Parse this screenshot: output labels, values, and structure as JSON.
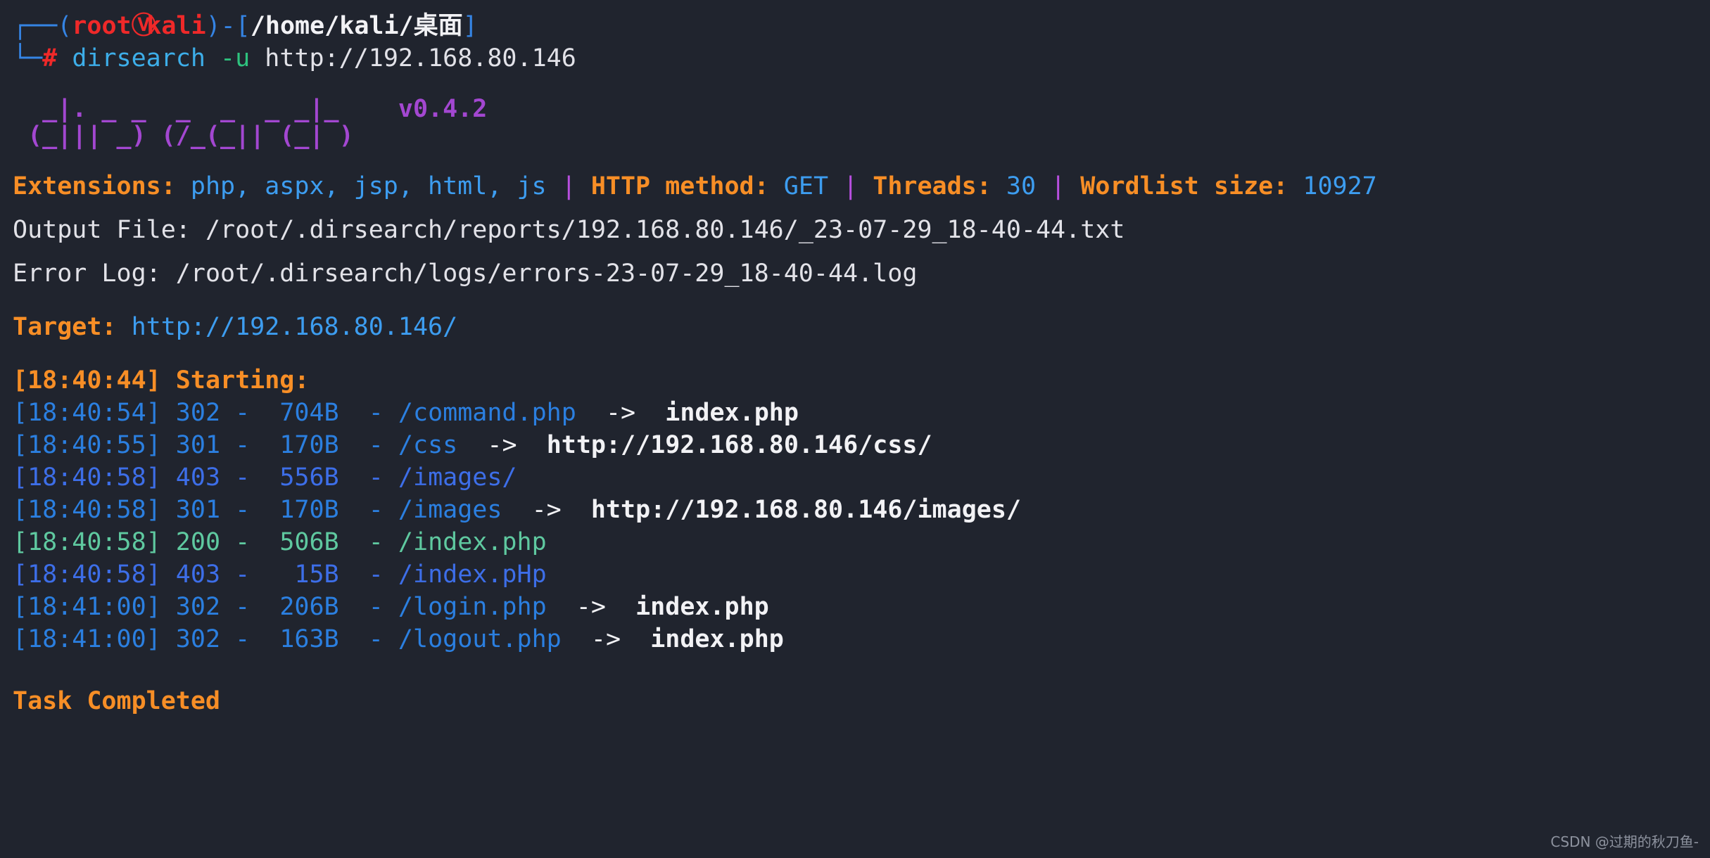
{
  "terminal": {
    "background": "#20242e",
    "prompt": {
      "box_top": "┌──",
      "box_bottom": "└─",
      "paren_open": "(",
      "user": "root",
      "kali_icon": "kali-dragon-icon",
      "host": "kali",
      "paren_close": ")",
      "dash": "-",
      "bracket_open": "[",
      "path": "/home/kali/桌面",
      "bracket_close": "]",
      "hash": "#",
      "command_name": "dirsearch",
      "command_flag": "-u",
      "command_arg": "http://192.168.80.146"
    },
    "logo": {
      "line1": "  _|. _ _  _  _  _ _|_    ",
      "line2": " (_||| _) (/_(_|| (_| )   ",
      "version": "v0.4.2"
    },
    "info_line": {
      "extensions_label": "Extensions:",
      "extensions_value": "php, aspx, jsp, html, js",
      "sep": "|",
      "method_label": "HTTP method:",
      "method_value": "GET",
      "threads_label": "Threads:",
      "threads_value": "30",
      "wordlist_label": "Wordlist size:",
      "wordlist_value": "10927"
    },
    "output_file_label": "Output File:",
    "output_file_value": "/root/.dirsearch/reports/192.168.80.146/_23-07-29_18-40-44.txt",
    "error_log_label": "Error Log:",
    "error_log_value": "/root/.dirsearch/logs/errors-23-07-29_18-40-44.log",
    "target_label": "Target:",
    "target_value": "http://192.168.80.146/",
    "starting": {
      "timestamp": "[18:40:44]",
      "label": "Starting:"
    },
    "results": [
      {
        "timestamp": "[18:40:54]",
        "status": "302",
        "dash1": "-",
        "size": "704B",
        "dash2": "-",
        "path": "/command.php",
        "arrow": "->",
        "redirect": "index.php",
        "color": "blue"
      },
      {
        "timestamp": "[18:40:55]",
        "status": "301",
        "dash1": "-",
        "size": "170B",
        "dash2": "-",
        "path": "/css",
        "arrow": "->",
        "redirect": "http://192.168.80.146/css/",
        "color": "blue"
      },
      {
        "timestamp": "[18:40:58]",
        "status": "403",
        "dash1": "-",
        "size": "556B",
        "dash2": "-",
        "path": "/images/",
        "arrow": "",
        "redirect": "",
        "color": "indigo"
      },
      {
        "timestamp": "[18:40:58]",
        "status": "301",
        "dash1": "-",
        "size": "170B",
        "dash2": "-",
        "path": "/images",
        "arrow": "->",
        "redirect": "http://192.168.80.146/images/",
        "color": "blue"
      },
      {
        "timestamp": "[18:40:58]",
        "status": "200",
        "dash1": "-",
        "size": "506B",
        "dash2": "-",
        "path": "/index.php",
        "arrow": "",
        "redirect": "",
        "color": "green"
      },
      {
        "timestamp": "[18:40:58]",
        "status": "403",
        "dash1": "-",
        "size": "15B",
        "dash2": "-",
        "path": "/index.pHp",
        "arrow": "",
        "redirect": "",
        "color": "indigo"
      },
      {
        "timestamp": "[18:41:00]",
        "status": "302",
        "dash1": "-",
        "size": "206B",
        "dash2": "-",
        "path": "/login.php",
        "arrow": "->",
        "redirect": "index.php",
        "color": "blue"
      },
      {
        "timestamp": "[18:41:00]",
        "status": "302",
        "dash1": "-",
        "size": "163B",
        "dash2": "-",
        "path": "/logout.php",
        "arrow": "->",
        "redirect": "index.php",
        "color": "blue"
      }
    ],
    "task_completed": "Task Completed",
    "watermark": "CSDN @过期的秋刀鱼-"
  }
}
